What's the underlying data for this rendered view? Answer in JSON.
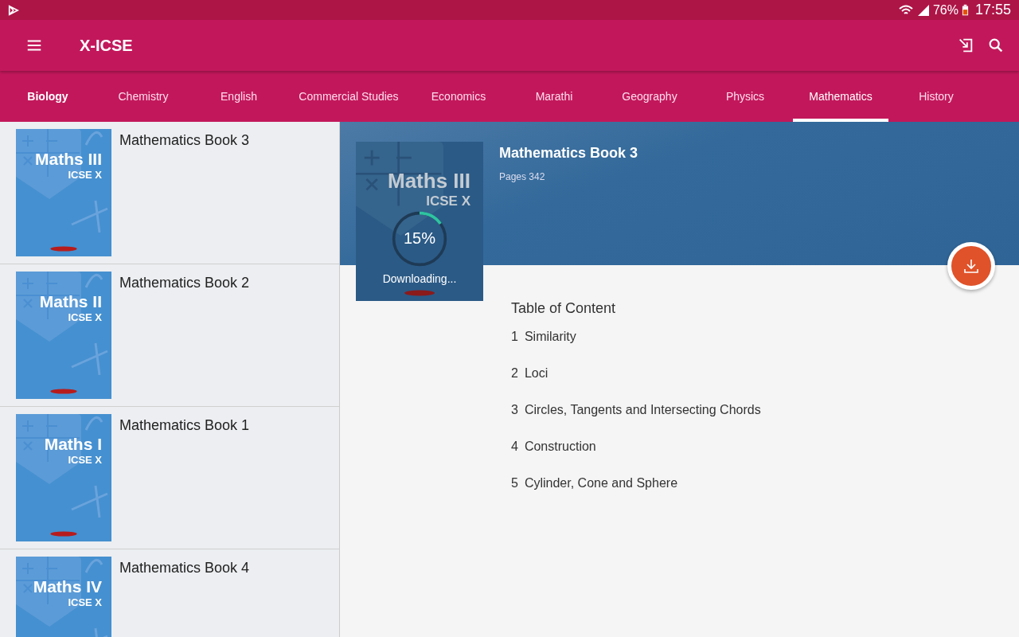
{
  "status_bar": {
    "battery": "76%",
    "time": "17:55"
  },
  "app_bar": {
    "title": "X-ICSE"
  },
  "tabs": [
    {
      "label": "Biology",
      "selected": false,
      "emphasized": true
    },
    {
      "label": "Chemistry",
      "selected": false,
      "emphasized": false
    },
    {
      "label": "English",
      "selected": false,
      "emphasized": false
    },
    {
      "label": "Commercial Studies",
      "selected": false,
      "emphasized": false
    },
    {
      "label": "Economics",
      "selected": false,
      "emphasized": false
    },
    {
      "label": "Marathi",
      "selected": false,
      "emphasized": false
    },
    {
      "label": "Geography",
      "selected": false,
      "emphasized": false
    },
    {
      "label": "Physics",
      "selected": false,
      "emphasized": false
    },
    {
      "label": "Mathematics",
      "selected": true,
      "emphasized": false
    },
    {
      "label": "History",
      "selected": false,
      "emphasized": false
    }
  ],
  "books": [
    {
      "title": "Mathematics Book 3",
      "cover_title": "Maths III",
      "cover_subtitle": "ICSE X"
    },
    {
      "title": "Mathematics Book 2",
      "cover_title": "Maths II",
      "cover_subtitle": "ICSE X"
    },
    {
      "title": "Mathematics Book 1",
      "cover_title": "Maths I",
      "cover_subtitle": "ICSE X"
    },
    {
      "title": "Mathematics Book 4",
      "cover_title": "Maths IV",
      "cover_subtitle": "ICSE X"
    }
  ],
  "detail": {
    "title": "Mathematics Book 3",
    "pages": "Pages 342",
    "cover_title": "Maths III",
    "cover_subtitle": "ICSE X",
    "download": {
      "percent": "15%",
      "level": 0.15,
      "status": "Downloading..."
    },
    "toc_heading": "Table of Content",
    "toc": [
      {
        "number": "1",
        "title": "Similarity"
      },
      {
        "number": "2",
        "title": "Loci"
      },
      {
        "number": "3",
        "title": "Circles, Tangents and Intersecting Chords"
      },
      {
        "number": "4",
        "title": "Construction"
      },
      {
        "number": "5",
        "title": "Cylinder, Cone and Sphere"
      }
    ]
  }
}
